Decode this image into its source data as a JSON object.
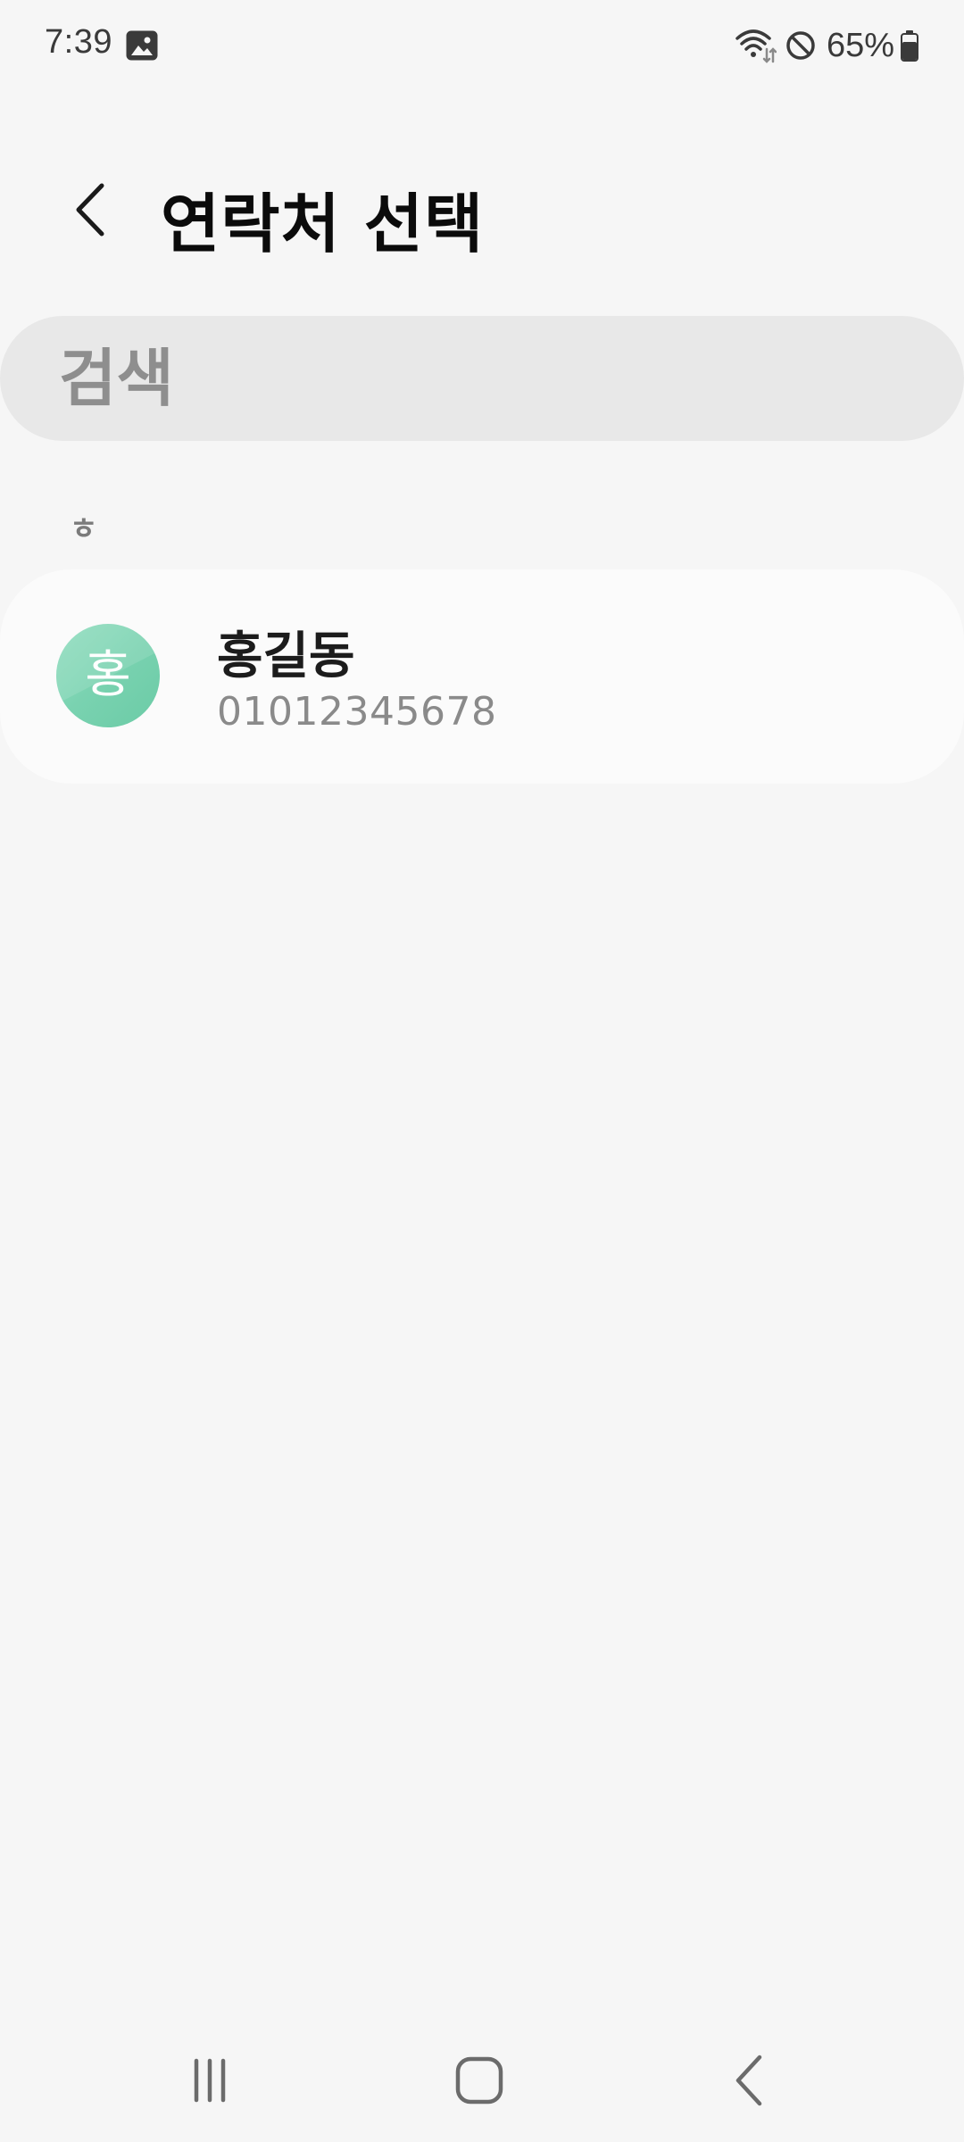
{
  "status_bar": {
    "time": "7:39",
    "battery_percent": "65%",
    "icons": [
      "gallery-icon",
      "wifi-icon",
      "do-not-disturb-icon",
      "battery-icon"
    ]
  },
  "app_bar": {
    "back_icon": "chevron-left-icon",
    "title": "연락처 선택"
  },
  "search": {
    "placeholder": "검색",
    "value": ""
  },
  "contacts": {
    "section_header": "ㅎ",
    "items": [
      {
        "initial": "홍",
        "name": "홍길동",
        "phone": "01012345678",
        "avatar_color": "#7ed6b4"
      }
    ]
  },
  "nav_bar": {
    "buttons": [
      "recent-apps-icon",
      "home-icon",
      "back-icon"
    ]
  },
  "colors": {
    "background": "#f6f6f6",
    "search_background": "#e8e8e8",
    "card_background": "#fbfbfb",
    "avatar": "#7ed6b4"
  }
}
